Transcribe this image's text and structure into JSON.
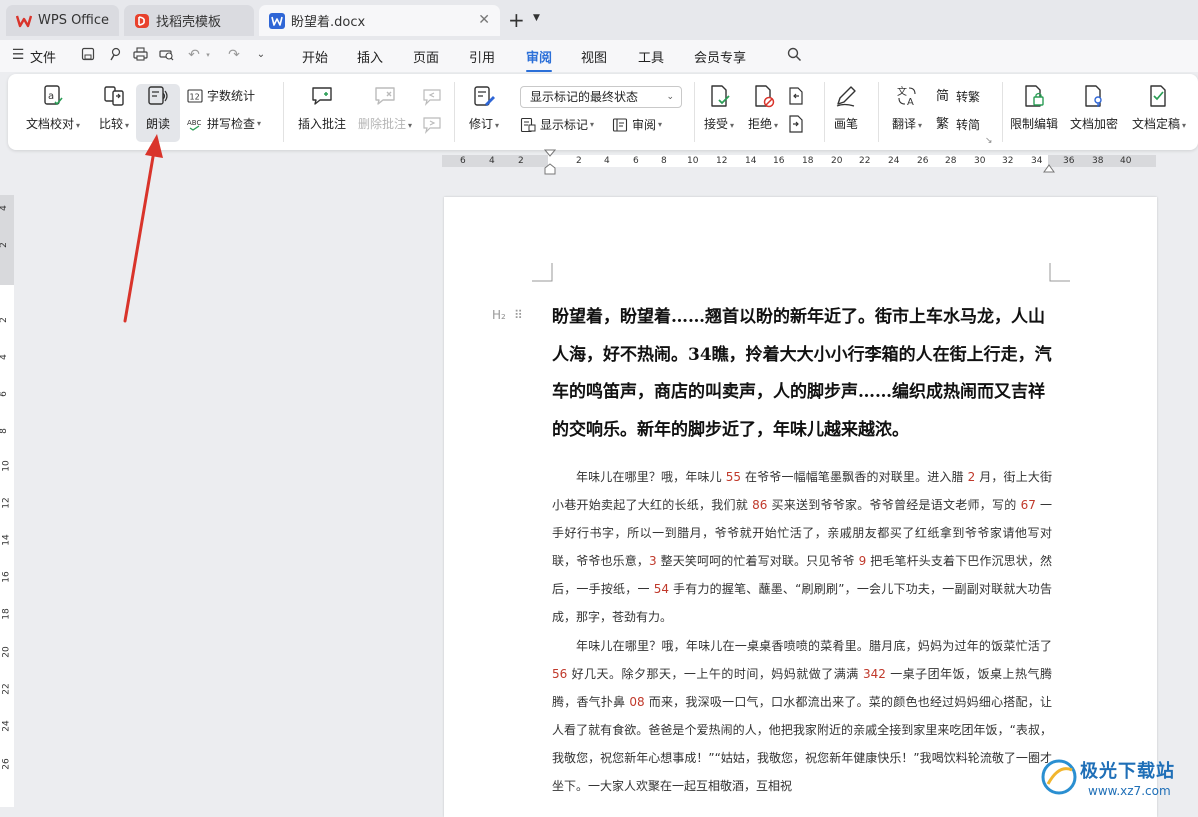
{
  "tabs": [
    {
      "label": "WPS Office",
      "icon": "wps-logo-icon"
    },
    {
      "label": "找稻壳模板",
      "icon": "docer-logo-icon"
    },
    {
      "label": "盼望着.docx",
      "icon": "word-doc-icon"
    }
  ],
  "menu": {
    "file": "文件",
    "items": [
      "开始",
      "插入",
      "页面",
      "引用",
      "审阅",
      "视图",
      "工具",
      "会员专享"
    ],
    "active": "审阅"
  },
  "ribbon": {
    "doc_check": "文档校对",
    "compare": "比较",
    "read_aloud": "朗读",
    "word_count": "字数统计",
    "spell_check": "拼写检查",
    "insert_comment": "插入批注",
    "delete_comment": "删除批注",
    "track": "修订",
    "display_state": "显示标记的最终状态",
    "show_markup": "显示标记",
    "review_pane": "审阅",
    "accept": "接受",
    "reject": "拒绝",
    "ink": "画笔",
    "translate": "翻译",
    "to_traditional": "转繁",
    "to_simplified": "转简",
    "restrict_edit": "限制编辑",
    "encrypt": "文档加密",
    "finalize": "文档定稿"
  },
  "ruler": {
    "h_ticks": [
      "6",
      "4",
      "2",
      "2",
      "4",
      "6",
      "8",
      "10",
      "12",
      "14",
      "16",
      "18",
      "20",
      "22",
      "24",
      "26",
      "28",
      "30",
      "32",
      "34",
      "36",
      "38",
      "40"
    ],
    "v_ticks": [
      "4",
      "2",
      "2",
      "4",
      "6",
      "8",
      "10",
      "12",
      "14",
      "16",
      "18",
      "20",
      "22",
      "24",
      "26"
    ]
  },
  "doc": {
    "heading_mark": "H₂",
    "heading": "盼望着，盼望着……翘首以盼的新年近了。街市上车水马龙，人山人海，好不热闹。34瞧，拎着大大小小行李箱的人在街上行走，汽车的鸣笛声，商店的叫卖声，人的脚步声……编织成热闹而又吉祥的交响乐。新年的脚步近了，年味儿越来越浓。",
    "p1": [
      {
        "t": "年味儿在哪里？哦，年味儿 "
      },
      {
        "n": "55"
      },
      {
        "t": " 在爷爷一幅幅笔墨飘香的对联里。进入腊 "
      },
      {
        "n": "2"
      },
      {
        "t": " 月，街上大街小巷开始卖起了大红的长纸，我们就 "
      },
      {
        "n": "86"
      },
      {
        "t": " 买来送到爷爷家。爷爷曾经是语文老师，写的 "
      },
      {
        "n": "67"
      },
      {
        "t": " 一手好行书字，所以一到腊月，爷爷就开始忙活了，亲戚朋友都买了红纸拿到爷爷家请他写对联，爷爷也乐意，"
      },
      {
        "n": "3"
      },
      {
        "t": " 整天笑呵呵的忙着写对联。只见爷爷 "
      },
      {
        "n": "9"
      },
      {
        "t": " 把毛笔杆头支着下巴作沉思状，然后，一手按纸，一 "
      },
      {
        "n": "54"
      },
      {
        "t": " 手有力的握笔、蘸墨、“刷刷刷”，一会儿下功夫，一副副对联就大功告成，那字，苍劲有力。"
      }
    ],
    "p2": [
      {
        "t": "年味儿在哪里？哦，年味儿在一桌桌香喷喷的菜肴里。腊月底，妈妈为过年的饭菜忙活了 "
      },
      {
        "n": "56"
      },
      {
        "t": " 好几天。除夕那天，一上午的时间，妈妈就做了满满 "
      },
      {
        "n": "342"
      },
      {
        "t": " 一桌子团年饭，饭桌上热气腾腾，香气扑鼻 "
      },
      {
        "n": "08"
      },
      {
        "t": " 而来，我深吸一口气，口水都流出来了。菜的颜色也经过妈妈细心搭配，让人看了就有食欲。爸爸是个爱热闹的人，他把我家附近的亲戚全接到家里来吃团年饭，“表叔，我敬您，祝您新年心想事成！”“姑姑，我敬您，祝您新年健康快乐！”我喝饮料轮流敬了一圈才坐下。一大家人欢聚在一起互相敬酒，互相祝"
      }
    ]
  },
  "watermark": {
    "title": "极光下载站",
    "url": "www.xz7.com"
  }
}
